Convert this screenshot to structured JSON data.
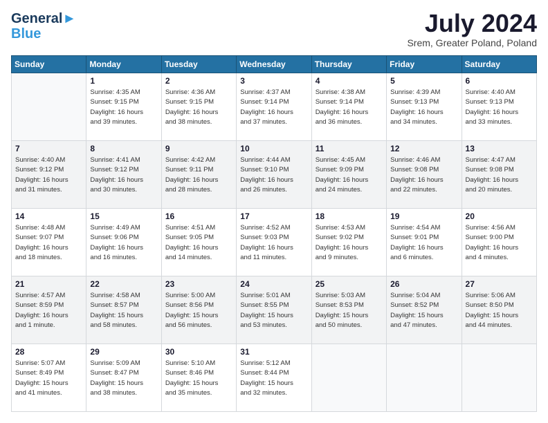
{
  "header": {
    "logo_line1": "General",
    "logo_line2": "Blue",
    "month_year": "July 2024",
    "location": "Srem, Greater Poland, Poland"
  },
  "weekdays": [
    "Sunday",
    "Monday",
    "Tuesday",
    "Wednesday",
    "Thursday",
    "Friday",
    "Saturday"
  ],
  "weeks": [
    [
      {
        "day": "",
        "info": ""
      },
      {
        "day": "1",
        "info": "Sunrise: 4:35 AM\nSunset: 9:15 PM\nDaylight: 16 hours\nand 39 minutes."
      },
      {
        "day": "2",
        "info": "Sunrise: 4:36 AM\nSunset: 9:15 PM\nDaylight: 16 hours\nand 38 minutes."
      },
      {
        "day": "3",
        "info": "Sunrise: 4:37 AM\nSunset: 9:14 PM\nDaylight: 16 hours\nand 37 minutes."
      },
      {
        "day": "4",
        "info": "Sunrise: 4:38 AM\nSunset: 9:14 PM\nDaylight: 16 hours\nand 36 minutes."
      },
      {
        "day": "5",
        "info": "Sunrise: 4:39 AM\nSunset: 9:13 PM\nDaylight: 16 hours\nand 34 minutes."
      },
      {
        "day": "6",
        "info": "Sunrise: 4:40 AM\nSunset: 9:13 PM\nDaylight: 16 hours\nand 33 minutes."
      }
    ],
    [
      {
        "day": "7",
        "info": "Sunrise: 4:40 AM\nSunset: 9:12 PM\nDaylight: 16 hours\nand 31 minutes."
      },
      {
        "day": "8",
        "info": "Sunrise: 4:41 AM\nSunset: 9:12 PM\nDaylight: 16 hours\nand 30 minutes."
      },
      {
        "day": "9",
        "info": "Sunrise: 4:42 AM\nSunset: 9:11 PM\nDaylight: 16 hours\nand 28 minutes."
      },
      {
        "day": "10",
        "info": "Sunrise: 4:44 AM\nSunset: 9:10 PM\nDaylight: 16 hours\nand 26 minutes."
      },
      {
        "day": "11",
        "info": "Sunrise: 4:45 AM\nSunset: 9:09 PM\nDaylight: 16 hours\nand 24 minutes."
      },
      {
        "day": "12",
        "info": "Sunrise: 4:46 AM\nSunset: 9:08 PM\nDaylight: 16 hours\nand 22 minutes."
      },
      {
        "day": "13",
        "info": "Sunrise: 4:47 AM\nSunset: 9:08 PM\nDaylight: 16 hours\nand 20 minutes."
      }
    ],
    [
      {
        "day": "14",
        "info": "Sunrise: 4:48 AM\nSunset: 9:07 PM\nDaylight: 16 hours\nand 18 minutes."
      },
      {
        "day": "15",
        "info": "Sunrise: 4:49 AM\nSunset: 9:06 PM\nDaylight: 16 hours\nand 16 minutes."
      },
      {
        "day": "16",
        "info": "Sunrise: 4:51 AM\nSunset: 9:05 PM\nDaylight: 16 hours\nand 14 minutes."
      },
      {
        "day": "17",
        "info": "Sunrise: 4:52 AM\nSunset: 9:03 PM\nDaylight: 16 hours\nand 11 minutes."
      },
      {
        "day": "18",
        "info": "Sunrise: 4:53 AM\nSunset: 9:02 PM\nDaylight: 16 hours\nand 9 minutes."
      },
      {
        "day": "19",
        "info": "Sunrise: 4:54 AM\nSunset: 9:01 PM\nDaylight: 16 hours\nand 6 minutes."
      },
      {
        "day": "20",
        "info": "Sunrise: 4:56 AM\nSunset: 9:00 PM\nDaylight: 16 hours\nand 4 minutes."
      }
    ],
    [
      {
        "day": "21",
        "info": "Sunrise: 4:57 AM\nSunset: 8:59 PM\nDaylight: 16 hours\nand 1 minute."
      },
      {
        "day": "22",
        "info": "Sunrise: 4:58 AM\nSunset: 8:57 PM\nDaylight: 15 hours\nand 58 minutes."
      },
      {
        "day": "23",
        "info": "Sunrise: 5:00 AM\nSunset: 8:56 PM\nDaylight: 15 hours\nand 56 minutes."
      },
      {
        "day": "24",
        "info": "Sunrise: 5:01 AM\nSunset: 8:55 PM\nDaylight: 15 hours\nand 53 minutes."
      },
      {
        "day": "25",
        "info": "Sunrise: 5:03 AM\nSunset: 8:53 PM\nDaylight: 15 hours\nand 50 minutes."
      },
      {
        "day": "26",
        "info": "Sunrise: 5:04 AM\nSunset: 8:52 PM\nDaylight: 15 hours\nand 47 minutes."
      },
      {
        "day": "27",
        "info": "Sunrise: 5:06 AM\nSunset: 8:50 PM\nDaylight: 15 hours\nand 44 minutes."
      }
    ],
    [
      {
        "day": "28",
        "info": "Sunrise: 5:07 AM\nSunset: 8:49 PM\nDaylight: 15 hours\nand 41 minutes."
      },
      {
        "day": "29",
        "info": "Sunrise: 5:09 AM\nSunset: 8:47 PM\nDaylight: 15 hours\nand 38 minutes."
      },
      {
        "day": "30",
        "info": "Sunrise: 5:10 AM\nSunset: 8:46 PM\nDaylight: 15 hours\nand 35 minutes."
      },
      {
        "day": "31",
        "info": "Sunrise: 5:12 AM\nSunset: 8:44 PM\nDaylight: 15 hours\nand 32 minutes."
      },
      {
        "day": "",
        "info": ""
      },
      {
        "day": "",
        "info": ""
      },
      {
        "day": "",
        "info": ""
      }
    ]
  ]
}
